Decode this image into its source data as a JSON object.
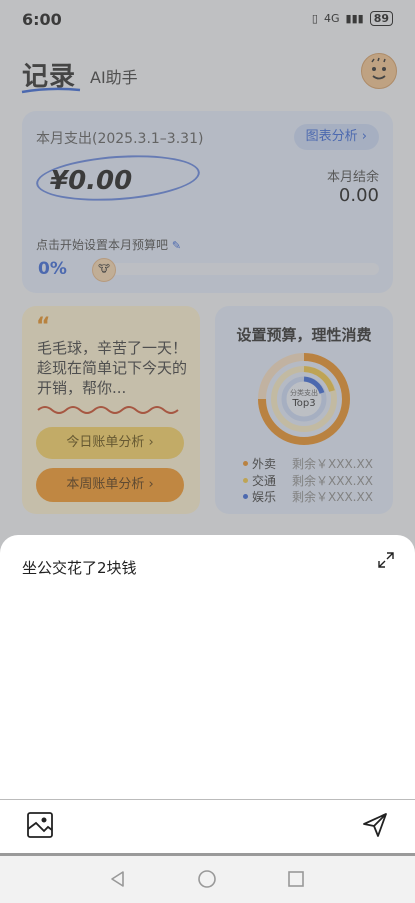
{
  "status_bar": {
    "time": "6:00",
    "network": "4G",
    "battery": "89"
  },
  "header": {
    "tab_record": "记录",
    "tab_ai": "AI助手"
  },
  "summary_card": {
    "title": "本月支出(2025.3.1–3.31)",
    "chart_button": "图表分析 ›",
    "amount": "¥0.00",
    "balance_label": "本月结余",
    "balance_value": "0.00",
    "budget_prompt": "点击开始设置本月预算吧",
    "progress_text": "0%",
    "progress_value": 0
  },
  "bill_card": {
    "message": "毛毛球，辛苦了一天！趁现在简单记下今天的开销，帮你...",
    "daily_button": "今日账单分析 ›",
    "weekly_button": "本周账单分析 ›"
  },
  "budget_card": {
    "title": "设置预算，理性消费",
    "donut_label": "分类支出",
    "donut_value": "Top3",
    "legend": [
      {
        "name": "外卖",
        "value": "剩余￥XXX.XX",
        "color": "#e98a1b"
      },
      {
        "name": "交通",
        "value": "剩余￥XXX.XX",
        "color": "#f2c53d"
      },
      {
        "name": "娱乐",
        "value": "剩余￥XXX.XX",
        "color": "#2d5fd8"
      }
    ]
  },
  "input_sheet": {
    "text": "坐公交花了2块钱"
  },
  "icons": {
    "expand": "expand-icon",
    "image": "image-icon",
    "send": "send-icon",
    "back": "back-icon",
    "home": "home-icon",
    "recents": "recents-icon"
  }
}
